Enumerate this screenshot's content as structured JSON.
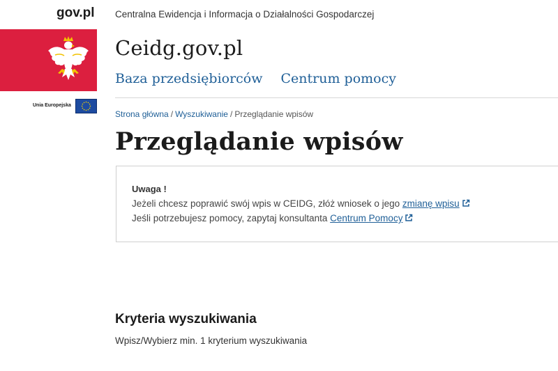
{
  "header": {
    "gov_logo": "gov.pl",
    "subtitle": "Centralna Ewidencja i Informacja o Działalności Gospodarczej",
    "site_title": "Ceidg.gov.pl",
    "eu_label": "Unia Europejska"
  },
  "nav": {
    "items": [
      {
        "label": "Baza przedsiębiorców"
      },
      {
        "label": "Centrum pomocy"
      }
    ]
  },
  "breadcrumb": {
    "items": [
      {
        "label": "Strona główna"
      },
      {
        "label": "Wyszukiwanie"
      },
      {
        "label": "Przeglądanie wpisów"
      }
    ],
    "separator": "/"
  },
  "page": {
    "title": "Przeglądanie wpisów"
  },
  "notice": {
    "title": "Uwaga !",
    "line1_text": "Jeżeli chcesz poprawić swój wpis w CEIDG, złóż wniosek o jego ",
    "line1_link": "zmianę wpisu",
    "line2_text": "Jeśli potrzebujesz pomocy, zapytaj konsultanta ",
    "line2_link": "Centrum Pomocy"
  },
  "criteria": {
    "title": "Kryteria wyszukiwania",
    "hint": "Wpisz/Wybierz min. 1 kryterium wyszukiwania"
  },
  "colors": {
    "link": "#1f5f97",
    "red_block": "#dc1f3f",
    "eu_blue": "#1d4ba0"
  },
  "icons": {
    "emblem": "polish-white-eagle-emblem",
    "eu_flag": "eu-flag-icon",
    "external_link": "external-link-icon"
  }
}
